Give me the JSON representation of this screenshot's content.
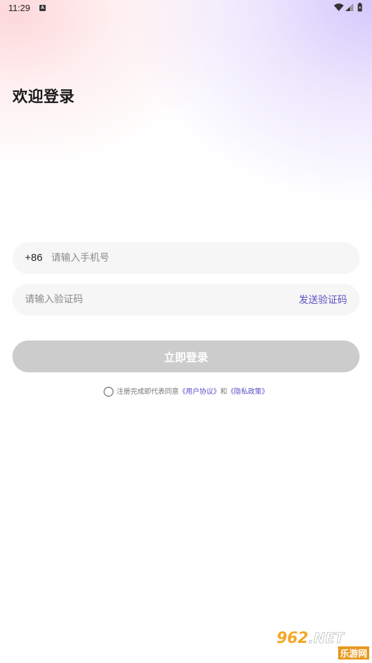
{
  "status_bar": {
    "time": "11:29",
    "notification_icon": "A"
  },
  "title": "欢迎登录",
  "phone": {
    "country_code": "+86",
    "placeholder": "请输入手机号",
    "value": ""
  },
  "code": {
    "placeholder": "请输入验证码",
    "value": "",
    "send_label": "发送验证码"
  },
  "login_button": "立即登录",
  "agreement": {
    "prefix": "注册完成即代表同意",
    "user_agreement": "《用户协议》",
    "conjunction": "和",
    "privacy_policy": "《隐私政策》",
    "checked": false
  },
  "watermark": {
    "main": "962",
    "suffix": ".NET",
    "sub": "乐游网"
  },
  "colors": {
    "accent": "#5a52c7",
    "button_disabled": "#cccccc",
    "field_bg": "#f5f6f5"
  }
}
